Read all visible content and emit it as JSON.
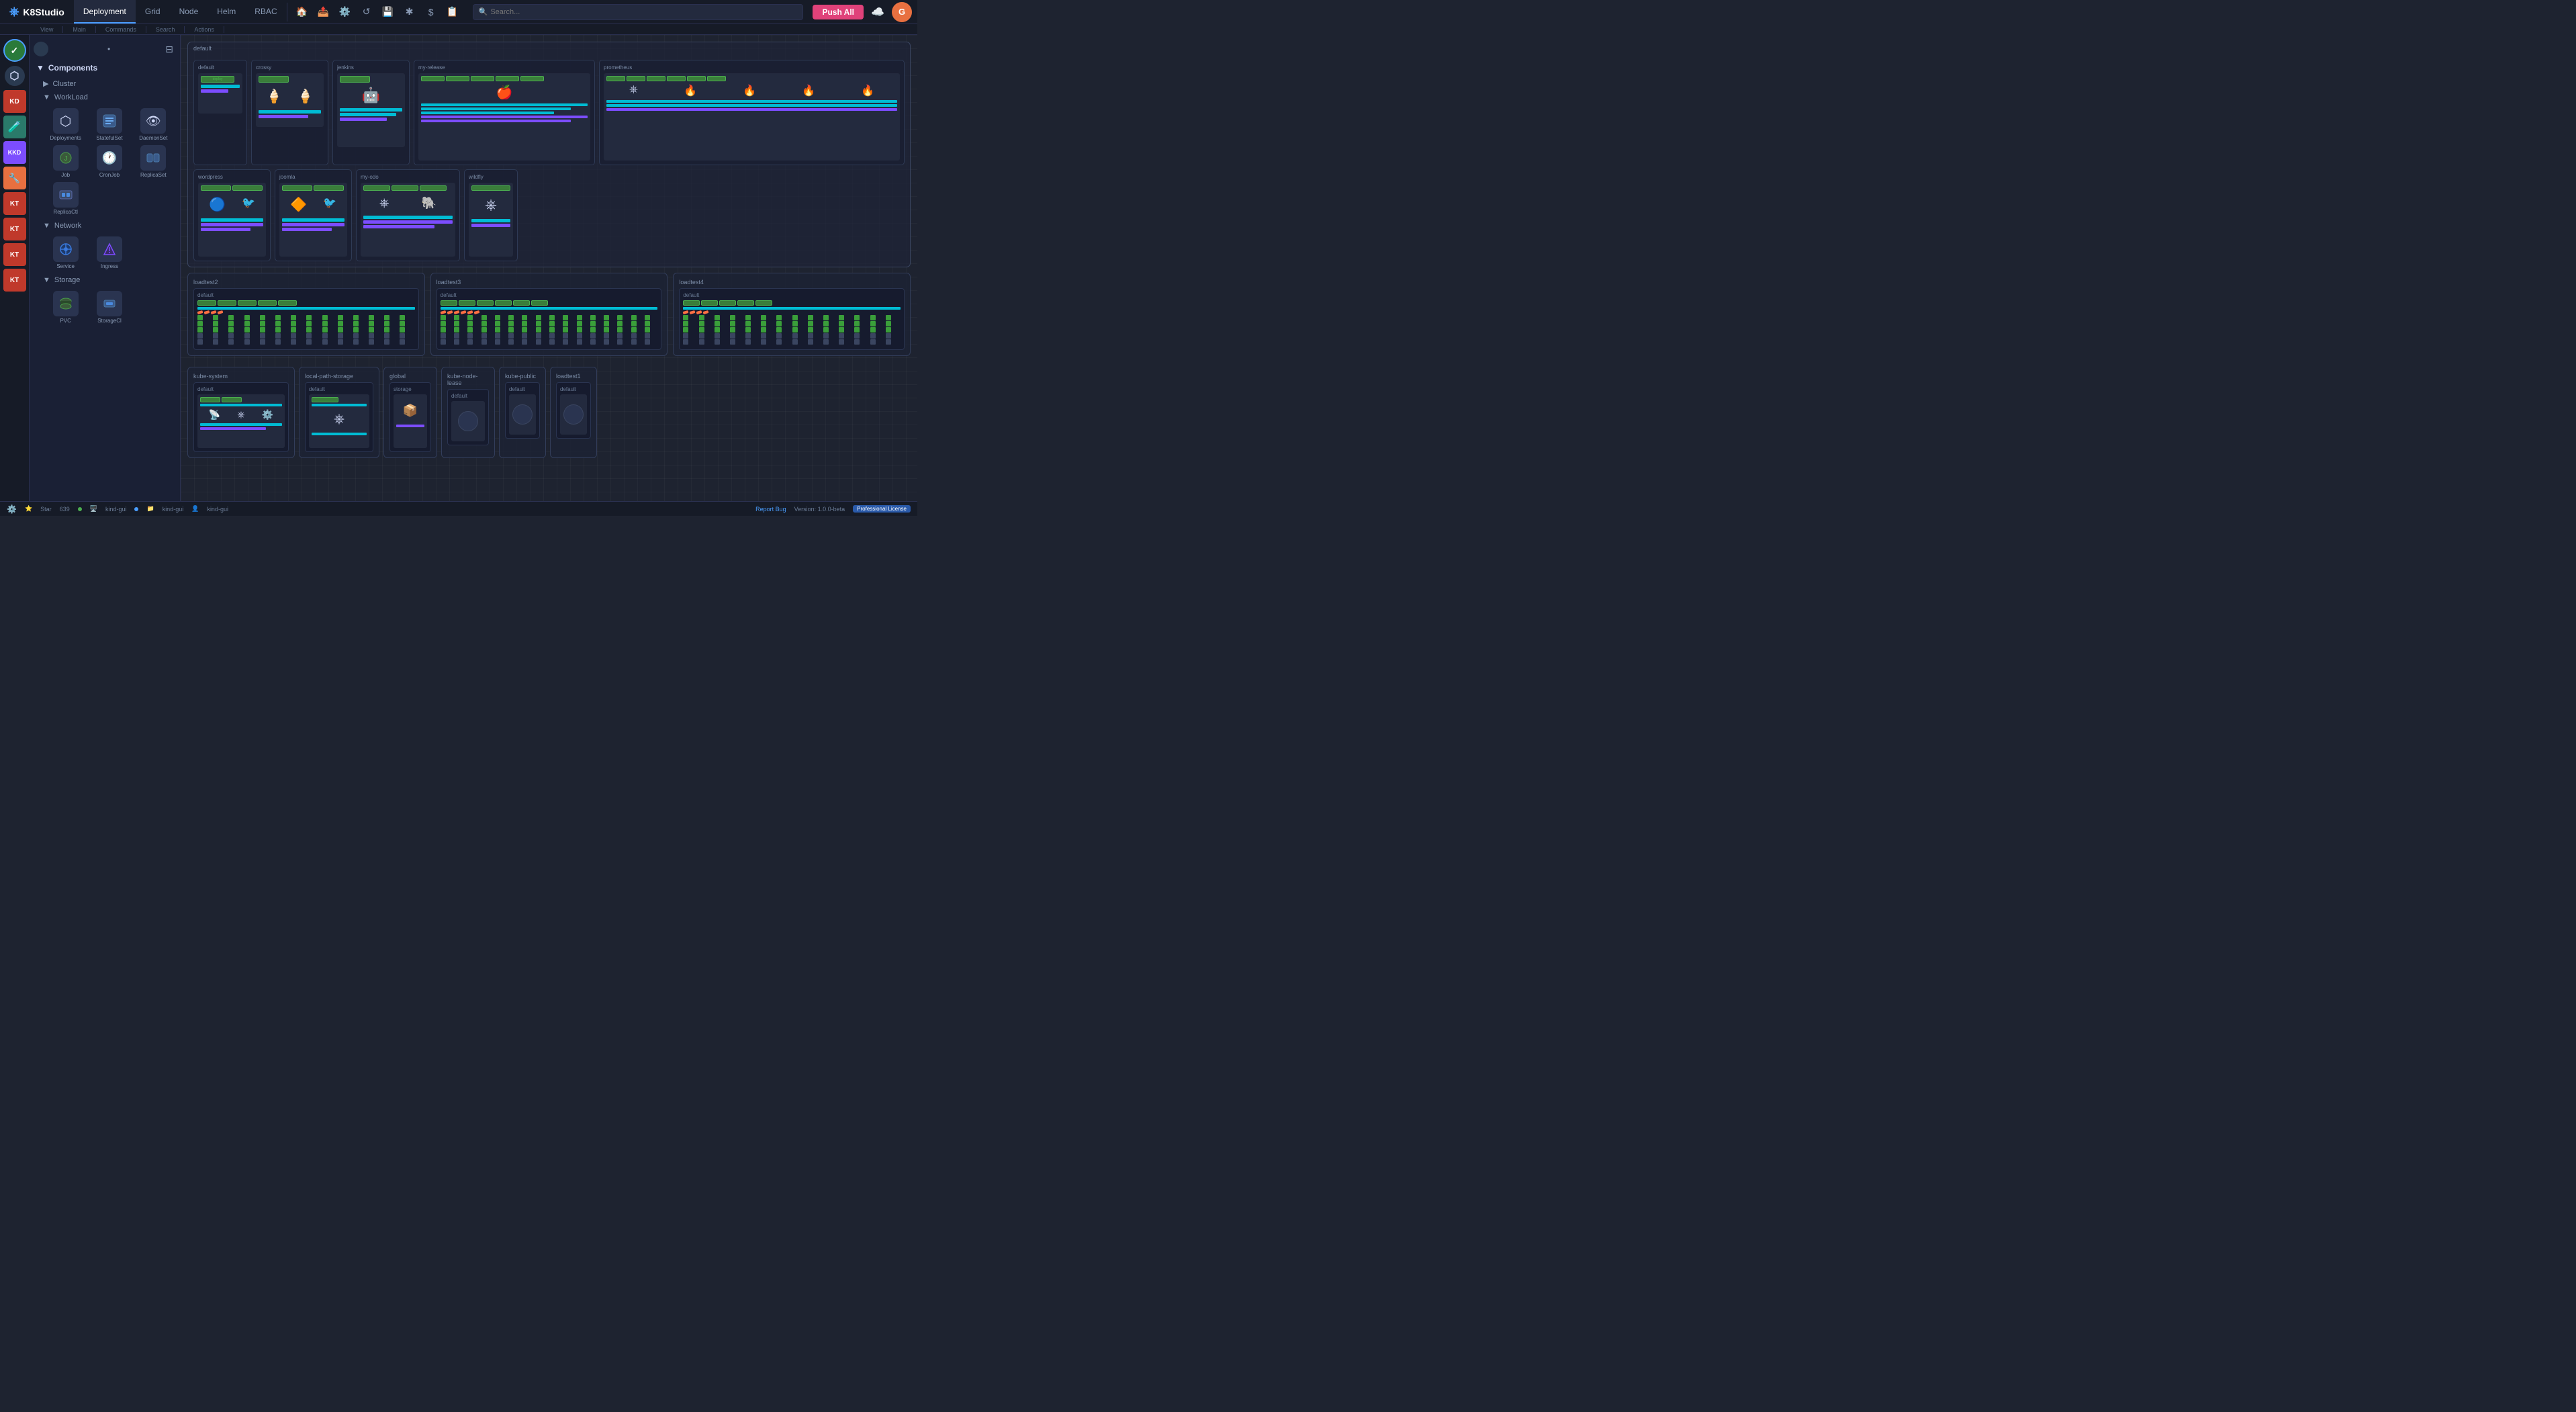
{
  "app": {
    "name": "K8Studio",
    "logo": "⎈"
  },
  "nav": {
    "tabs": [
      {
        "id": "deployment",
        "label": "Deployment",
        "active": true
      },
      {
        "id": "grid",
        "label": "Grid"
      },
      {
        "id": "node",
        "label": "Node"
      },
      {
        "id": "helm",
        "label": "Helm"
      },
      {
        "id": "rbac",
        "label": "RBAC"
      }
    ],
    "section_labels": [
      "View",
      "Main",
      "Commands",
      "Search",
      "Actions"
    ]
  },
  "toolbar": {
    "search_placeholder": "Search...",
    "push_all_label": "Push All"
  },
  "sidebar": {
    "filter_icon": "⊟",
    "sections": {
      "components_label": "Components",
      "cluster_label": "Cluster",
      "workload_label": "WorkLoad",
      "network_label": "Network",
      "storage_label": "Storage"
    },
    "workload_items": [
      {
        "label": "Deployments",
        "icon": "⬡"
      },
      {
        "label": "StatefulSet",
        "icon": "⬡"
      },
      {
        "label": "DaemonSet",
        "icon": "👁"
      },
      {
        "label": "Job",
        "icon": "⬡"
      },
      {
        "label": "CronJob",
        "icon": "🕐"
      },
      {
        "label": "ReplicaSet",
        "icon": "⬡"
      },
      {
        "label": "ReplicaCtl",
        "icon": "⬡"
      }
    ],
    "network_items": [
      {
        "label": "Service",
        "icon": "⬡"
      },
      {
        "label": "Ingress",
        "icon": "⬡"
      }
    ],
    "storage_items": [
      {
        "label": "PVC",
        "icon": "⬡"
      },
      {
        "label": "StorageCl",
        "icon": "⬡"
      }
    ]
  },
  "avatar_sidebar": {
    "items": [
      {
        "id": "check",
        "label": "✓",
        "color": "#2a7a3a",
        "active": true
      },
      {
        "id": "nav1",
        "label": "⬡",
        "color": "#2a3a5a"
      },
      {
        "id": "kd",
        "label": "KD",
        "color": "#c0392b"
      },
      {
        "id": "flask",
        "label": "🧪",
        "color": "#2a7a6a"
      },
      {
        "id": "kkd",
        "label": "KKD",
        "color": "#7c4dff"
      },
      {
        "id": "tools",
        "label": "🔧",
        "color": "#e87040"
      },
      {
        "id": "kt1",
        "label": "KT",
        "color": "#c0392b"
      },
      {
        "id": "kt2",
        "label": "KT",
        "color": "#c0392b"
      },
      {
        "id": "kt3",
        "label": "KT",
        "color": "#c0392b"
      },
      {
        "id": "kt4",
        "label": "KT",
        "color": "#c0392b"
      }
    ]
  },
  "canvas": {
    "namespaces": {
      "default_group": {
        "label": "default",
        "workspaces": [
          {
            "name": "default",
            "has_content": true
          },
          {
            "name": "crossy",
            "has_content": true
          },
          {
            "name": "jenkins",
            "has_content": true
          },
          {
            "name": "my-release",
            "has_content": true
          },
          {
            "name": "prometheus",
            "has_content": true
          },
          {
            "name": "wordpress",
            "has_content": true
          },
          {
            "name": "joomla",
            "has_content": true
          },
          {
            "name": "my-odo",
            "has_content": true
          },
          {
            "name": "wildfly",
            "has_content": true
          }
        ]
      },
      "loadtest_groups": [
        {
          "name": "loadtest2",
          "has_pods": true
        },
        {
          "name": "loadtest3",
          "has_pods": true
        },
        {
          "name": "loadtest4",
          "has_pods": true
        }
      ],
      "small_groups": [
        {
          "name": "kube-system"
        },
        {
          "name": "local-path-storage"
        },
        {
          "name": "global"
        },
        {
          "name": "kube-node-lease"
        },
        {
          "name": "kube-public"
        },
        {
          "name": "loadtest1"
        }
      ]
    }
  },
  "status_bar": {
    "star_label": "Star",
    "star_count": "639",
    "cluster_label": "kind-gui",
    "namespace_label": "kind-gui",
    "user_label": "kind-gui",
    "report_bug": "Report Bug",
    "version": "Version: 1.0.0-beta",
    "license": "Professional License"
  },
  "user": {
    "initial": "G"
  }
}
